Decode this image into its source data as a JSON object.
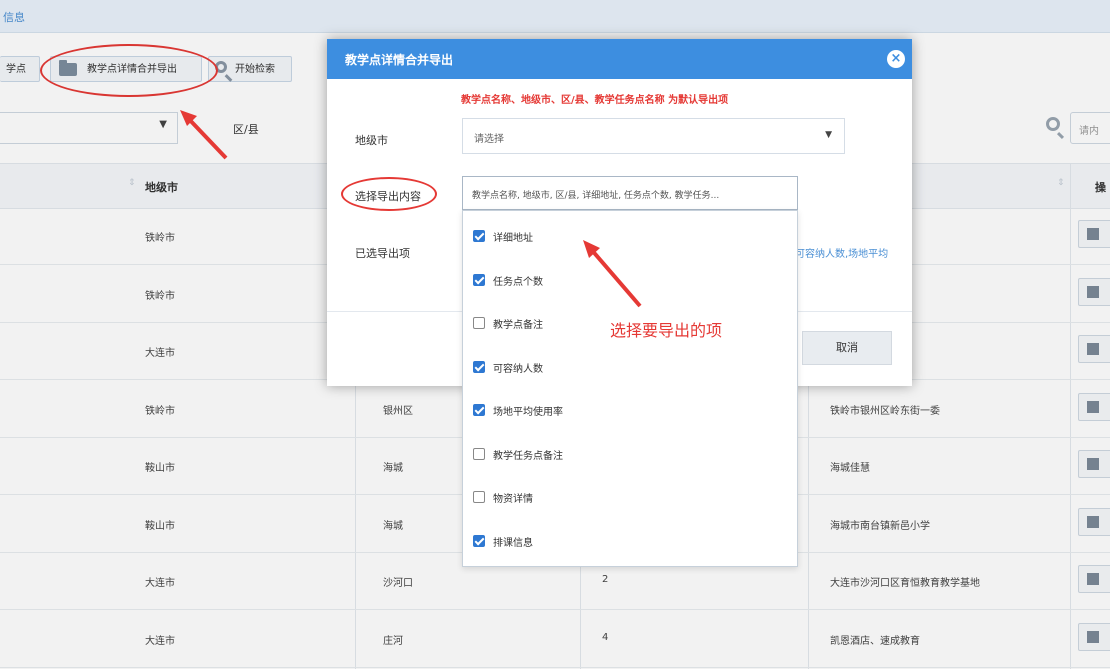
{
  "topbar": {
    "title": "信息"
  },
  "toolbar": {
    "btn0_label": "学点",
    "btn1_label": "教学点详情合并导出",
    "btn2_label": "开始检索"
  },
  "filters": {
    "district_label": "区/县",
    "search_placeholder": "请内"
  },
  "table": {
    "headers": [
      "地级市",
      "操"
    ],
    "rows": [
      {
        "city": "铁岭市",
        "district": "",
        "count": "",
        "address": ""
      },
      {
        "city": "铁岭市",
        "district": "",
        "count": "",
        "address": ""
      },
      {
        "city": "大连市",
        "district": "",
        "count": "",
        "address": ""
      },
      {
        "city": "铁岭市",
        "district": "银州区",
        "count": "",
        "address": "铁岭市银州区岭东街一委"
      },
      {
        "city": "鞍山市",
        "district": "海城",
        "count": "",
        "address": "海城佳慧"
      },
      {
        "city": "鞍山市",
        "district": "海城",
        "count": "",
        "address": "海城市南台镇新邑小学"
      },
      {
        "city": "大连市",
        "district": "沙河口",
        "count": "2",
        "address": "大连市沙河口区育恒教育教学基地"
      },
      {
        "city": "大连市",
        "district": "庄河",
        "count": "4",
        "address": "凯恩酒店、速成教育"
      }
    ]
  },
  "dialog": {
    "title": "教学点详情合并导出",
    "close_glyph": "×",
    "note": "教学点名称、地级市、区/县、教学任务点名称 为默认导出项",
    "city_label": "地级市",
    "city_placeholder": "请选择",
    "content_label": "选择导出内容",
    "content_value": "教学点名称, 地级市, 区/县, 详细地址, 任务点个数, 教学任务...",
    "selected_label": "已选导出项",
    "selected_value_visible": "可容纳人数,场地平均",
    "cancel_label": "取消"
  },
  "dropdown": {
    "options": [
      {
        "label": "详细地址",
        "checked": true
      },
      {
        "label": "任务点个数",
        "checked": true
      },
      {
        "label": "教学点备注",
        "checked": false
      },
      {
        "label": "可容纳人数",
        "checked": true
      },
      {
        "label": "场地平均使用率",
        "checked": true
      },
      {
        "label": "教学任务点备注",
        "checked": false
      },
      {
        "label": "物资详情",
        "checked": false
      },
      {
        "label": "排课信息",
        "checked": true
      }
    ]
  },
  "annotation": {
    "text": "选择要导出的项",
    "color": "#e53935"
  },
  "colors": {
    "primary": "#3d8ee0",
    "checkbox": "#2e78d2",
    "alert": "#e53935"
  }
}
